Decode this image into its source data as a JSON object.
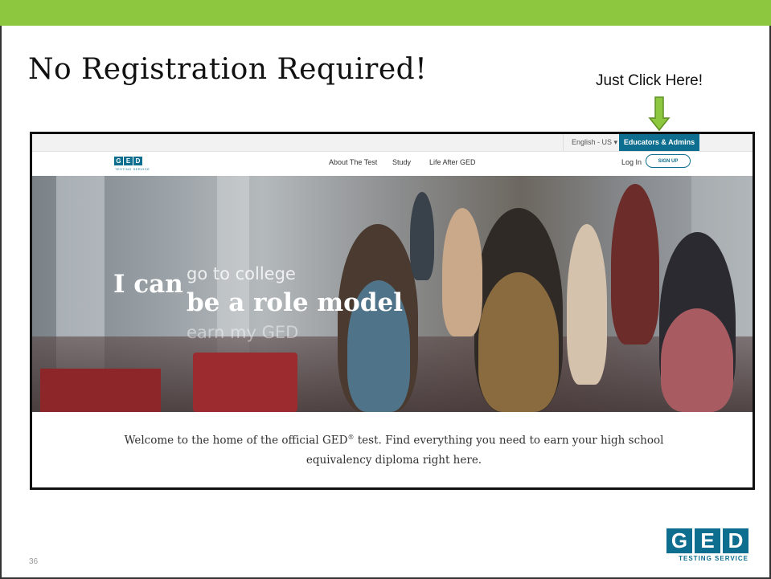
{
  "slide": {
    "title": "No Registration Required!",
    "callout": "Just Click Here!",
    "page_number": "36",
    "accent_color": "#8dc63f"
  },
  "screenshot": {
    "util_bar": {
      "language": "English - US ▾",
      "educators_button": "Educators & Admins"
    },
    "nav": {
      "logo_letters": [
        "G",
        "E",
        "D"
      ],
      "logo_sub": "TESTING SERVICE",
      "links": [
        "About The Test",
        "Study",
        "Life After GED"
      ],
      "login": "Log In",
      "signup": "SIGN UP"
    },
    "hero": {
      "prefix": "I can",
      "line1": "go to college",
      "line2": "be a role model",
      "line3": "earn my GED"
    },
    "welcome": {
      "part1": "Welcome to the home of the official GED",
      "reg": "®",
      "part2": " test. Find everything you need to earn your high school equivalency diploma right here."
    }
  },
  "brand_logo": {
    "letters": [
      "G",
      "E",
      "D"
    ],
    "sub": "TESTING SERVICE"
  },
  "colors": {
    "brand": "#0e6e8f",
    "arrow": "#8dc63f"
  }
}
